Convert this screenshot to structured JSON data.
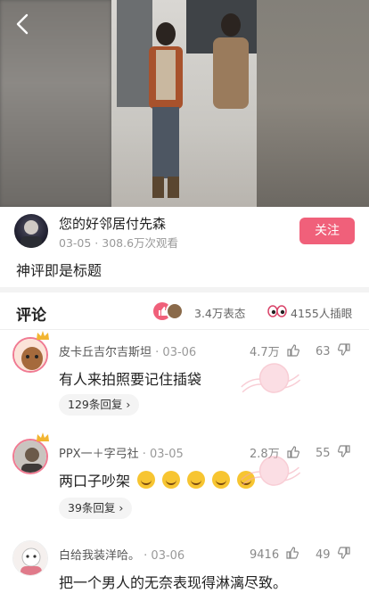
{
  "post": {
    "author_name": "您的好邻居付先森",
    "meta": "03-05 · 308.6万次观看",
    "follow_label": "关注",
    "title": "神评即是标题"
  },
  "comments_header": {
    "title": "评论",
    "reactions_count": "3.4万表态",
    "inserts_count": "4155人插眼"
  },
  "comments": [
    {
      "user": "皮卡丘吉尔吉斯坦",
      "date": "03-06",
      "likes": "4.7万",
      "dislikes": "63",
      "text": "有人来拍照要记住插袋",
      "replies": "129条回复 ›"
    },
    {
      "user": "PPX一＋字弓社",
      "date": "03-05",
      "likes": "2.8万",
      "dislikes": "55",
      "text": "两口子吵架",
      "emojis": 5,
      "replies": "39条回复 ›"
    },
    {
      "user": "白给我装洋哈。",
      "date": "03-06",
      "likes": "9416",
      "dislikes": "49",
      "text": "把一个男人的无奈表现得淋漓尽致。"
    }
  ],
  "colors": {
    "accent": "#f0607a",
    "divider": "#f3f3f3"
  }
}
